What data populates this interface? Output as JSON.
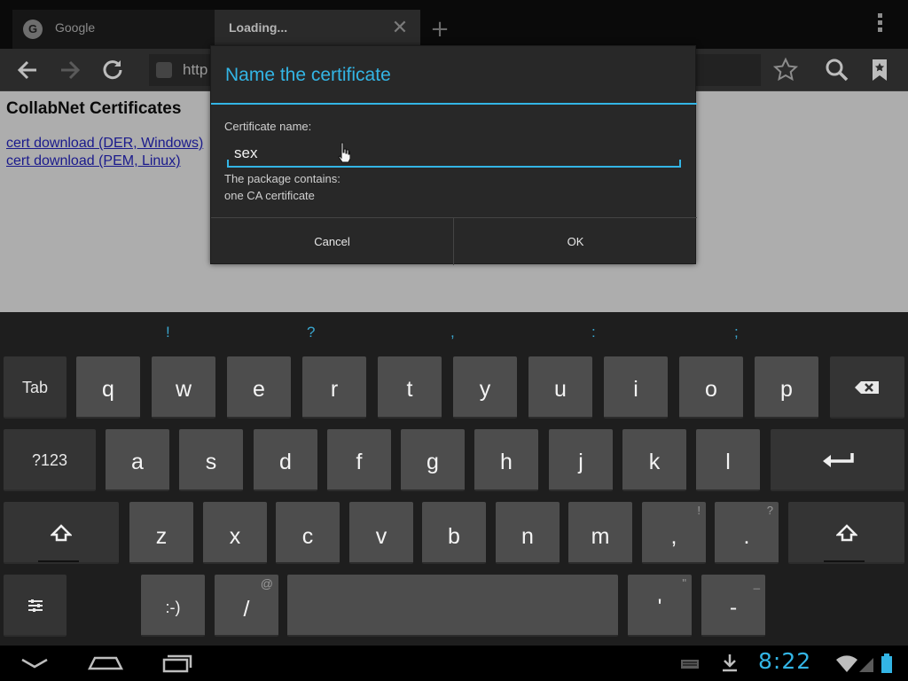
{
  "browser": {
    "tabs": [
      {
        "title": "Google",
        "favicon": "G",
        "active": false
      },
      {
        "title": "Loading...",
        "active": true,
        "close_glyph": "✕"
      }
    ],
    "new_tab_glyph": "+",
    "url_text": "http",
    "toolbar_icons": [
      "back-arrow-icon",
      "forward-arrow-icon",
      "refresh-icon",
      "star-icon",
      "search-icon",
      "bookmarks-icon",
      "overflow-menu-icon"
    ]
  },
  "page": {
    "title": "CollabNet Certificates",
    "links": [
      "cert download (DER, Windows)",
      "cert download (PEM, Linux)"
    ]
  },
  "dialog": {
    "title": "Name the certificate",
    "name_label": "Certificate name:",
    "name_value": "sex",
    "info_line1": "The package contains:",
    "info_line2": "one CA certificate",
    "cancel_label": "Cancel",
    "ok_label": "OK",
    "accent_color": "#33b5e5"
  },
  "keyboard": {
    "hints": [
      "!",
      "?",
      ",",
      ":",
      ";"
    ],
    "row1": {
      "tab": "Tab",
      "keys": [
        "q",
        "w",
        "e",
        "r",
        "t",
        "y",
        "u",
        "i",
        "o",
        "p"
      ],
      "backspace_icon": "backspace-icon"
    },
    "row2": {
      "mode": "?123",
      "keys": [
        "a",
        "s",
        "d",
        "f",
        "g",
        "h",
        "j",
        "k",
        "l"
      ],
      "enter_icon": "enter-icon"
    },
    "row3": {
      "keys": [
        "z",
        "x",
        "c",
        "v",
        "b",
        "n",
        "m"
      ],
      "comma": ",",
      "comma_hint": "!",
      "period": ".",
      "period_hint": "?",
      "shift_icon": "shift-icon"
    },
    "row4": {
      "settings_icon": "settings-icon",
      "smiley": ":-)",
      "slash": "/",
      "slash_hint": "@",
      "apostrophe": "'",
      "apostrophe_hint": "\"",
      "dash": "-",
      "dash_hint": "_"
    }
  },
  "navbar": {
    "icons": [
      "hide-keyboard-icon",
      "home-icon",
      "recent-apps-icon",
      "keyboard-icon",
      "download-icon",
      "wifi-icon",
      "signal-icon",
      "battery-icon"
    ],
    "time": "8:22",
    "accent_color": "#33b5e5"
  }
}
